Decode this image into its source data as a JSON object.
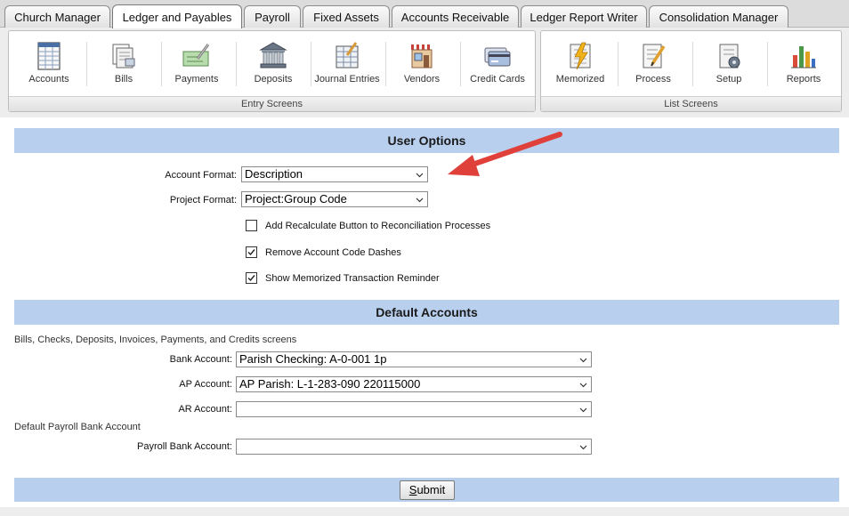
{
  "tabs": [
    {
      "label": "Church Manager"
    },
    {
      "label": "Ledger and Payables",
      "active": true
    },
    {
      "label": "Payroll"
    },
    {
      "label": "Fixed Assets"
    },
    {
      "label": "Accounts Receivable"
    },
    {
      "label": "Ledger Report Writer"
    },
    {
      "label": "Consolidation Manager"
    }
  ],
  "ribbon": {
    "entry_group": {
      "caption": "Entry Screens",
      "items": [
        {
          "label": "Accounts",
          "icon": "ledger-grid-icon"
        },
        {
          "label": "Bills",
          "icon": "bills-stack-icon"
        },
        {
          "label": "Payments",
          "icon": "check-pen-icon"
        },
        {
          "label": "Deposits",
          "icon": "bank-building-icon"
        },
        {
          "label": "Journal Entries",
          "icon": "journal-book-icon"
        },
        {
          "label": "Vendors",
          "icon": "storefront-icon"
        },
        {
          "label": "Credit Cards",
          "icon": "credit-cards-icon"
        }
      ]
    },
    "list_group": {
      "caption": "List Screens",
      "items": [
        {
          "label": "Memorized",
          "icon": "memorized-bolt-icon"
        },
        {
          "label": "Process",
          "icon": "process-pencil-icon"
        },
        {
          "label": "Setup",
          "icon": "setup-dial-icon"
        },
        {
          "label": "Reports",
          "icon": "bar-chart-icon"
        }
      ]
    }
  },
  "user_options": {
    "header": "User Options",
    "account_format": {
      "label": "Account Format:",
      "value": "Description"
    },
    "project_format": {
      "label": "Project Format:",
      "value": "Project:Group Code"
    },
    "checkboxes": [
      {
        "label": "Add Recalculate Button to Reconciliation Processes",
        "checked": false
      },
      {
        "label": "Remove Account Code Dashes",
        "checked": true
      },
      {
        "label": "Show Memorized Transaction Reminder",
        "checked": true
      }
    ]
  },
  "default_accounts": {
    "header": "Default Accounts",
    "screens_note": "Bills, Checks, Deposits, Invoices, Payments, and Credits screens",
    "bank_account": {
      "label": "Bank Account:",
      "value": "Parish Checking: A-0-001 1p"
    },
    "ap_account": {
      "label": "AP Account:",
      "value": "AP Parish: L-1-283-090 220115000"
    },
    "ar_account": {
      "label": "AR Account:",
      "value": ""
    },
    "payroll_note": "Default Payroll Bank Account",
    "payroll_bank_account": {
      "label": "Payroll Bank Account:",
      "value": ""
    }
  },
  "submit": {
    "first_letter": "S",
    "rest": "ubmit"
  },
  "colors": {
    "section_header": "#b8cfee",
    "annotation_arrow": "#e0403a"
  }
}
